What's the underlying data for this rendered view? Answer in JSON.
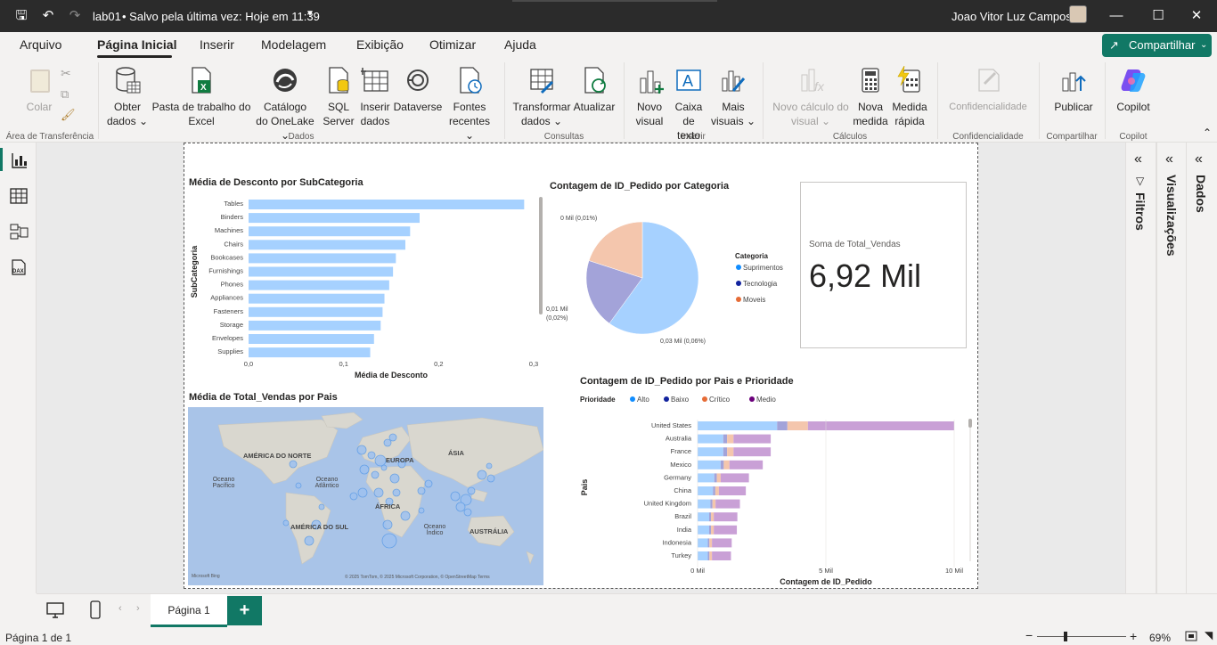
{
  "titlebar": {
    "file_name": "lab01",
    "save_status": "•  Salvo pela última vez: Hoje em 11:39",
    "user_name": "Joao Vitor Luz Campos"
  },
  "menu": {
    "tabs": [
      "Arquivo",
      "Página Inicial",
      "Inserir",
      "Modelagem",
      "Exibição",
      "Otimizar",
      "Ajuda"
    ],
    "share_label": "Compartilhar"
  },
  "ribbon": {
    "paste": "Colar",
    "get_data": [
      "Obter",
      "dados"
    ],
    "excel": [
      "Pasta de trabalho do",
      "Excel"
    ],
    "onelake": [
      "Catálogo",
      "do OneLake"
    ],
    "sql": [
      "SQL",
      "Server"
    ],
    "insert_data": [
      "Inserir",
      "dados"
    ],
    "dataverse": "Dataverse",
    "recent": [
      "Fontes",
      "recentes"
    ],
    "transform": [
      "Transformar",
      "dados"
    ],
    "refresh": "Atualizar",
    "new_visual": [
      "Novo",
      "visual"
    ],
    "textbox": [
      "Caixa de",
      "texto"
    ],
    "more_visuals": [
      "Mais",
      "visuais"
    ],
    "new_calc": [
      "Novo cálculo do",
      "visual"
    ],
    "new_measure": [
      "Nova",
      "medida"
    ],
    "quick_measure": [
      "Medida",
      "rápida"
    ],
    "sensitivity": "Confidencialidade",
    "publish": "Publicar",
    "copilot": "Copilot",
    "groups": {
      "clipboard": "Área de Transferência",
      "data": "Dados",
      "queries": "Consultas",
      "insert": "Inserir",
      "calculations": "Cálculos",
      "sensitivity": "Confidencialidade",
      "share": "Compartilhar",
      "copilot": "Copilot"
    }
  },
  "panes": {
    "filters": "Filtros",
    "visualizations": "Visualizações",
    "data": "Dados"
  },
  "card": {
    "label": "Soma de Total_Vendas",
    "value": "6,92 Mil"
  },
  "map": {
    "title": "Média de Total_Vendas por Pais",
    "labels": [
      "AMÉRICA DO NORTE",
      "EUROPA",
      "ÁSIA",
      "Oceano Pacífico",
      "Oceano Atlântico",
      "ÁFRICA",
      "AMÉRICA DO SUL",
      "Oceano Índico",
      "AUSTRÁLIA"
    ],
    "attribution": "© 2025 TomTom, © 2025 Microsoft Corporation, © OpenStreetMap  Terms",
    "bing": "Microsoft Bing"
  },
  "chart_data": [
    {
      "type": "bar",
      "title": "Média de Desconto por SubCategoria",
      "xlabel": "Média de Desconto",
      "ylabel": "SubCategoria",
      "categories": [
        "Tables",
        "Binders",
        "Machines",
        "Chairs",
        "Bookcases",
        "Furnishings",
        "Phones",
        "Appliances",
        "Fasteners",
        "Storage",
        "Envelopes",
        "Supplies"
      ],
      "values": [
        0.29,
        0.18,
        0.17,
        0.165,
        0.155,
        0.152,
        0.148,
        0.143,
        0.141,
        0.139,
        0.132,
        0.128
      ],
      "xticks": [
        "0,0",
        "0,1",
        "0,2",
        "0,3"
      ],
      "xlim": [
        0,
        0.3
      ],
      "color": "#a6d1ff"
    },
    {
      "type": "pie",
      "title": "Contagem de ID_Pedido por Categoria",
      "legend_title": "Categoria",
      "legend_position": "right",
      "slices": [
        {
          "name": "Suprimentos",
          "value": 0.06,
          "color": "#a6d1ff",
          "label": "0,03 Mil (0,06%)"
        },
        {
          "name": "Tecnologia",
          "value": 0.02,
          "color": "#a3a3d9",
          "label": "0,01 Mil (0,02%)"
        },
        {
          "name": "Moveis",
          "value": 0.02,
          "color": "#f4c6ad",
          "label": "0 Mil (0,01%)"
        }
      ],
      "legend_colors": [
        "#118dff",
        "#12239e",
        "#e66c37"
      ]
    },
    {
      "type": "bar",
      "stacked": true,
      "title": "Contagem de ID_Pedido por Pais e Prioridade",
      "legend_title": "Prioridade",
      "legend_position": "top-left",
      "xlabel": "Contagem de ID_Pedido",
      "ylabel": "Pais",
      "xticks": [
        "0 Mil",
        "5 Mil",
        "10 Mil"
      ],
      "xlim": [
        0,
        10000
      ],
      "categories": [
        "United States",
        "Australia",
        "France",
        "Mexico",
        "Germany",
        "China",
        "United Kingdom",
        "Brazil",
        "India",
        "Indonesia",
        "Turkey"
      ],
      "series": [
        {
          "name": "Alto",
          "color": "#a6d1ff",
          "legend_color": "#118dff",
          "values": [
            3100,
            1000,
            1000,
            900,
            650,
            600,
            500,
            450,
            450,
            400,
            400
          ]
        },
        {
          "name": "Baixo",
          "color": "#a3a3d9",
          "legend_color": "#12239e",
          "values": [
            400,
            150,
            150,
            120,
            100,
            90,
            80,
            70,
            70,
            60,
            60
          ]
        },
        {
          "name": "Crítico",
          "color": "#f4c6ad",
          "legend_color": "#e66c37",
          "values": [
            800,
            250,
            250,
            220,
            150,
            140,
            120,
            110,
            110,
            100,
            100
          ]
        },
        {
          "name": "Medio",
          "color": "#c9a0d6",
          "legend_color": "#6b007b",
          "values": [
            5700,
            1450,
            1450,
            1300,
            1100,
            1050,
            950,
            920,
            900,
            770,
            740
          ]
        }
      ]
    }
  ],
  "page_tabs": {
    "current": "Página 1",
    "add": "+"
  },
  "status": {
    "page_info": "Página 1 de 1",
    "zoom": "69%",
    "minus": "−",
    "plus": "+"
  }
}
